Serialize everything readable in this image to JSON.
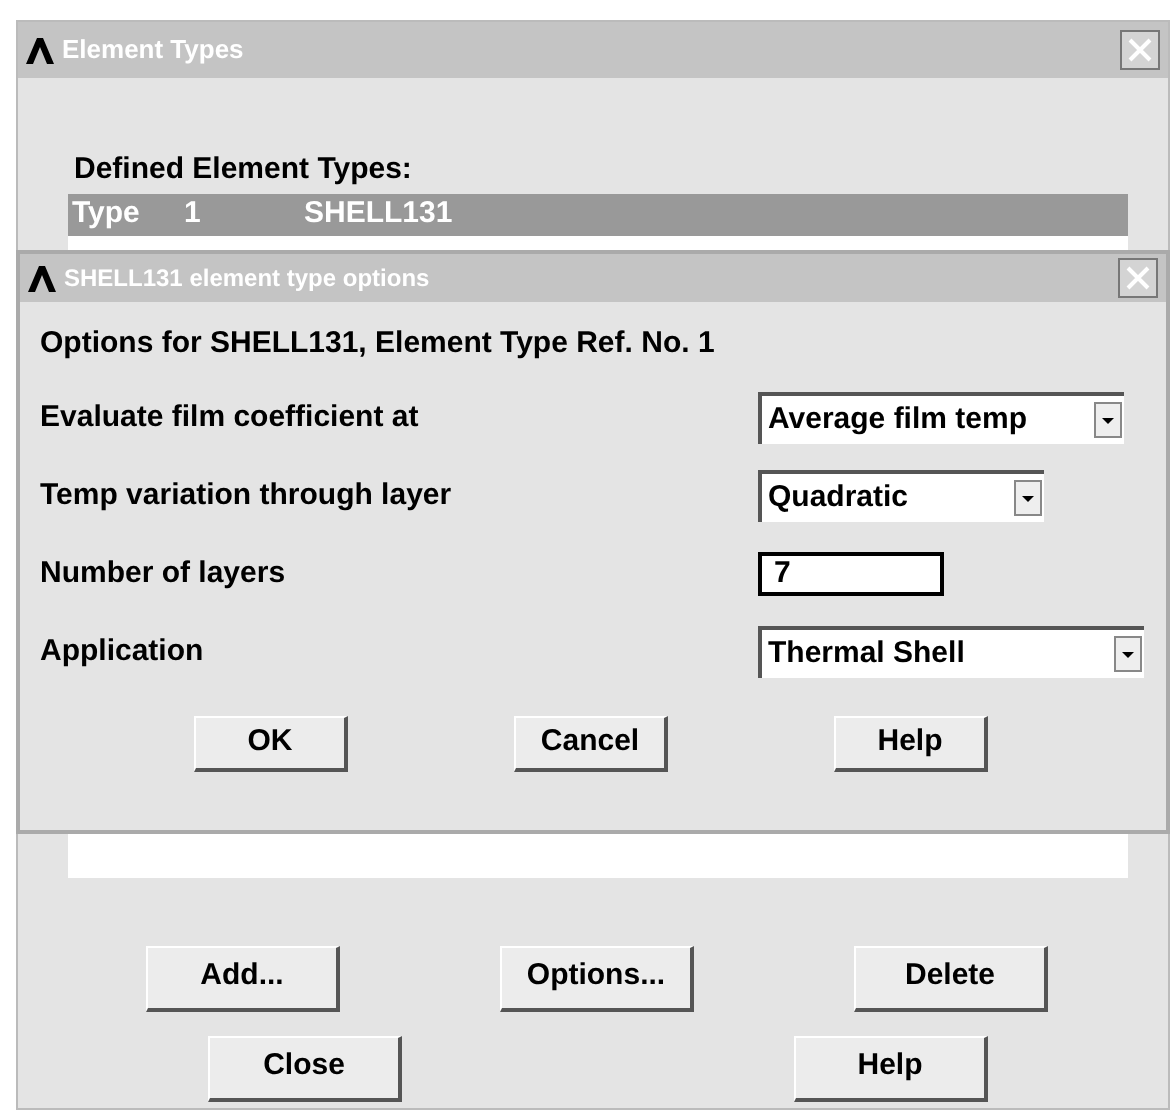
{
  "window": {
    "title": "Element Types"
  },
  "list": {
    "label": "Defined Element Types:",
    "rows": [
      {
        "type": "Type",
        "number": "1",
        "name": "SHELL131",
        "selected": true
      }
    ]
  },
  "action_buttons": [
    "Add...",
    "Options...",
    "Delete"
  ],
  "bottom_buttons": [
    "Close",
    "Help"
  ],
  "dialog": {
    "title": "SHELL131 element type options",
    "heading": "Options for SHELL131, Element Type Ref. No. 1",
    "fields": [
      {
        "label": "Evaluate film coefficient at",
        "kind": "dropdown",
        "value": "Average film temp"
      },
      {
        "label": "Temp variation through layer",
        "kind": "dropdown",
        "value": "Quadratic"
      },
      {
        "label": "Number of layers",
        "kind": "input",
        "value": "7"
      },
      {
        "label": "Application",
        "kind": "dropdown",
        "value": "Thermal Shell"
      }
    ],
    "buttons": [
      "OK",
      "Cancel",
      "Help"
    ]
  }
}
